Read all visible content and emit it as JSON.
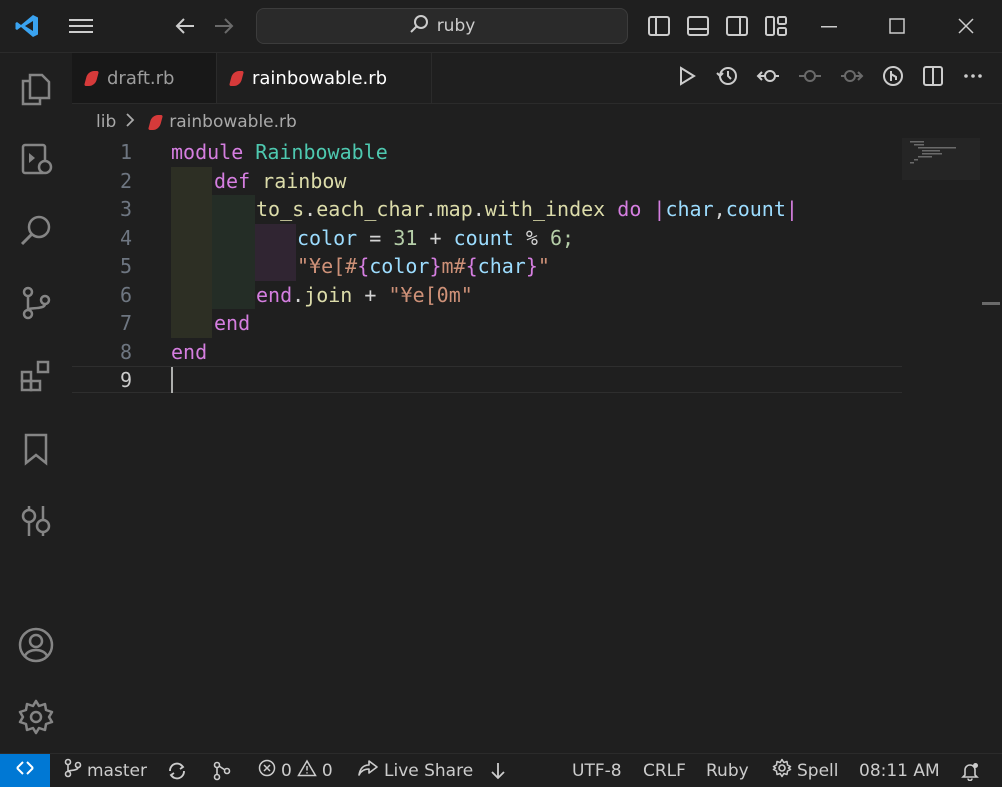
{
  "titlebar": {
    "search_text": "ruby"
  },
  "tabs": [
    {
      "label": "draft.rb"
    },
    {
      "label": "rainbowable.rb"
    }
  ],
  "breadcrumb": {
    "folder": "lib",
    "file": "rainbowable.rb"
  },
  "editor": {
    "line_numbers": [
      "1",
      "2",
      "3",
      "4",
      "5",
      "6",
      "7",
      "8",
      "9"
    ],
    "lines": {
      "l1": {
        "kw": "module",
        "cls": "Rainbowable"
      },
      "l2": {
        "kw": "def",
        "fn": "rainbow"
      },
      "l3": {
        "a": "to_s",
        "b": ".",
        "c": "each_char",
        "d": ".",
        "e": "map",
        "f": ".",
        "g": "with_index",
        "h": "do",
        "i": "|",
        "j": "char",
        "k": ",",
        "l": "count",
        "m": "|"
      },
      "l4": {
        "a": "color",
        "b": "=",
        "c": "31",
        "d": "+",
        "e": "count",
        "f": "%",
        "g": "6;"
      },
      "l5": {
        "a": "\"¥e[#",
        "b": "{",
        "c": "color",
        "d": "}",
        "e": "m#",
        "f": "{",
        "g": "char",
        "h": "}",
        "i": "\""
      },
      "l6": {
        "a": "end",
        "b": ".",
        "c": "join",
        "d": "+",
        "e": "\"¥e[0m\""
      },
      "l7": {
        "kw": "end"
      },
      "l8": {
        "kw": "end"
      }
    }
  },
  "statusbar": {
    "branch": "master",
    "errors": "0",
    "warnings": "0",
    "live_share": "Live Share",
    "encoding": "UTF-8",
    "eol": "CRLF",
    "language": "Ruby",
    "spell": "Spell",
    "time": "08:11 AM"
  },
  "colors": {
    "accent": "#0078d4",
    "ruby_red": "#d63a3a"
  }
}
